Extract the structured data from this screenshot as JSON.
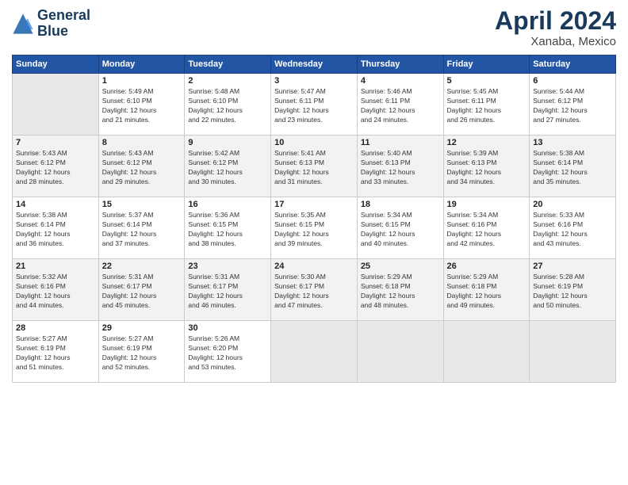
{
  "logo": {
    "line1": "General",
    "line2": "Blue"
  },
  "title": "April 2024",
  "location": "Xanaba, Mexico",
  "headers": [
    "Sunday",
    "Monday",
    "Tuesday",
    "Wednesday",
    "Thursday",
    "Friday",
    "Saturday"
  ],
  "weeks": [
    [
      {
        "day": "",
        "detail": ""
      },
      {
        "day": "1",
        "detail": "Sunrise: 5:49 AM\nSunset: 6:10 PM\nDaylight: 12 hours\nand 21 minutes."
      },
      {
        "day": "2",
        "detail": "Sunrise: 5:48 AM\nSunset: 6:10 PM\nDaylight: 12 hours\nand 22 minutes."
      },
      {
        "day": "3",
        "detail": "Sunrise: 5:47 AM\nSunset: 6:11 PM\nDaylight: 12 hours\nand 23 minutes."
      },
      {
        "day": "4",
        "detail": "Sunrise: 5:46 AM\nSunset: 6:11 PM\nDaylight: 12 hours\nand 24 minutes."
      },
      {
        "day": "5",
        "detail": "Sunrise: 5:45 AM\nSunset: 6:11 PM\nDaylight: 12 hours\nand 26 minutes."
      },
      {
        "day": "6",
        "detail": "Sunrise: 5:44 AM\nSunset: 6:12 PM\nDaylight: 12 hours\nand 27 minutes."
      }
    ],
    [
      {
        "day": "7",
        "detail": "Sunrise: 5:43 AM\nSunset: 6:12 PM\nDaylight: 12 hours\nand 28 minutes."
      },
      {
        "day": "8",
        "detail": "Sunrise: 5:43 AM\nSunset: 6:12 PM\nDaylight: 12 hours\nand 29 minutes."
      },
      {
        "day": "9",
        "detail": "Sunrise: 5:42 AM\nSunset: 6:12 PM\nDaylight: 12 hours\nand 30 minutes."
      },
      {
        "day": "10",
        "detail": "Sunrise: 5:41 AM\nSunset: 6:13 PM\nDaylight: 12 hours\nand 31 minutes."
      },
      {
        "day": "11",
        "detail": "Sunrise: 5:40 AM\nSunset: 6:13 PM\nDaylight: 12 hours\nand 33 minutes."
      },
      {
        "day": "12",
        "detail": "Sunrise: 5:39 AM\nSunset: 6:13 PM\nDaylight: 12 hours\nand 34 minutes."
      },
      {
        "day": "13",
        "detail": "Sunrise: 5:38 AM\nSunset: 6:14 PM\nDaylight: 12 hours\nand 35 minutes."
      }
    ],
    [
      {
        "day": "14",
        "detail": "Sunrise: 5:38 AM\nSunset: 6:14 PM\nDaylight: 12 hours\nand 36 minutes."
      },
      {
        "day": "15",
        "detail": "Sunrise: 5:37 AM\nSunset: 6:14 PM\nDaylight: 12 hours\nand 37 minutes."
      },
      {
        "day": "16",
        "detail": "Sunrise: 5:36 AM\nSunset: 6:15 PM\nDaylight: 12 hours\nand 38 minutes."
      },
      {
        "day": "17",
        "detail": "Sunrise: 5:35 AM\nSunset: 6:15 PM\nDaylight: 12 hours\nand 39 minutes."
      },
      {
        "day": "18",
        "detail": "Sunrise: 5:34 AM\nSunset: 6:15 PM\nDaylight: 12 hours\nand 40 minutes."
      },
      {
        "day": "19",
        "detail": "Sunrise: 5:34 AM\nSunset: 6:16 PM\nDaylight: 12 hours\nand 42 minutes."
      },
      {
        "day": "20",
        "detail": "Sunrise: 5:33 AM\nSunset: 6:16 PM\nDaylight: 12 hours\nand 43 minutes."
      }
    ],
    [
      {
        "day": "21",
        "detail": "Sunrise: 5:32 AM\nSunset: 6:16 PM\nDaylight: 12 hours\nand 44 minutes."
      },
      {
        "day": "22",
        "detail": "Sunrise: 5:31 AM\nSunset: 6:17 PM\nDaylight: 12 hours\nand 45 minutes."
      },
      {
        "day": "23",
        "detail": "Sunrise: 5:31 AM\nSunset: 6:17 PM\nDaylight: 12 hours\nand 46 minutes."
      },
      {
        "day": "24",
        "detail": "Sunrise: 5:30 AM\nSunset: 6:17 PM\nDaylight: 12 hours\nand 47 minutes."
      },
      {
        "day": "25",
        "detail": "Sunrise: 5:29 AM\nSunset: 6:18 PM\nDaylight: 12 hours\nand 48 minutes."
      },
      {
        "day": "26",
        "detail": "Sunrise: 5:29 AM\nSunset: 6:18 PM\nDaylight: 12 hours\nand 49 minutes."
      },
      {
        "day": "27",
        "detail": "Sunrise: 5:28 AM\nSunset: 6:19 PM\nDaylight: 12 hours\nand 50 minutes."
      }
    ],
    [
      {
        "day": "28",
        "detail": "Sunrise: 5:27 AM\nSunset: 6:19 PM\nDaylight: 12 hours\nand 51 minutes."
      },
      {
        "day": "29",
        "detail": "Sunrise: 5:27 AM\nSunset: 6:19 PM\nDaylight: 12 hours\nand 52 minutes."
      },
      {
        "day": "30",
        "detail": "Sunrise: 5:26 AM\nSunset: 6:20 PM\nDaylight: 12 hours\nand 53 minutes."
      },
      {
        "day": "",
        "detail": ""
      },
      {
        "day": "",
        "detail": ""
      },
      {
        "day": "",
        "detail": ""
      },
      {
        "day": "",
        "detail": ""
      }
    ]
  ]
}
